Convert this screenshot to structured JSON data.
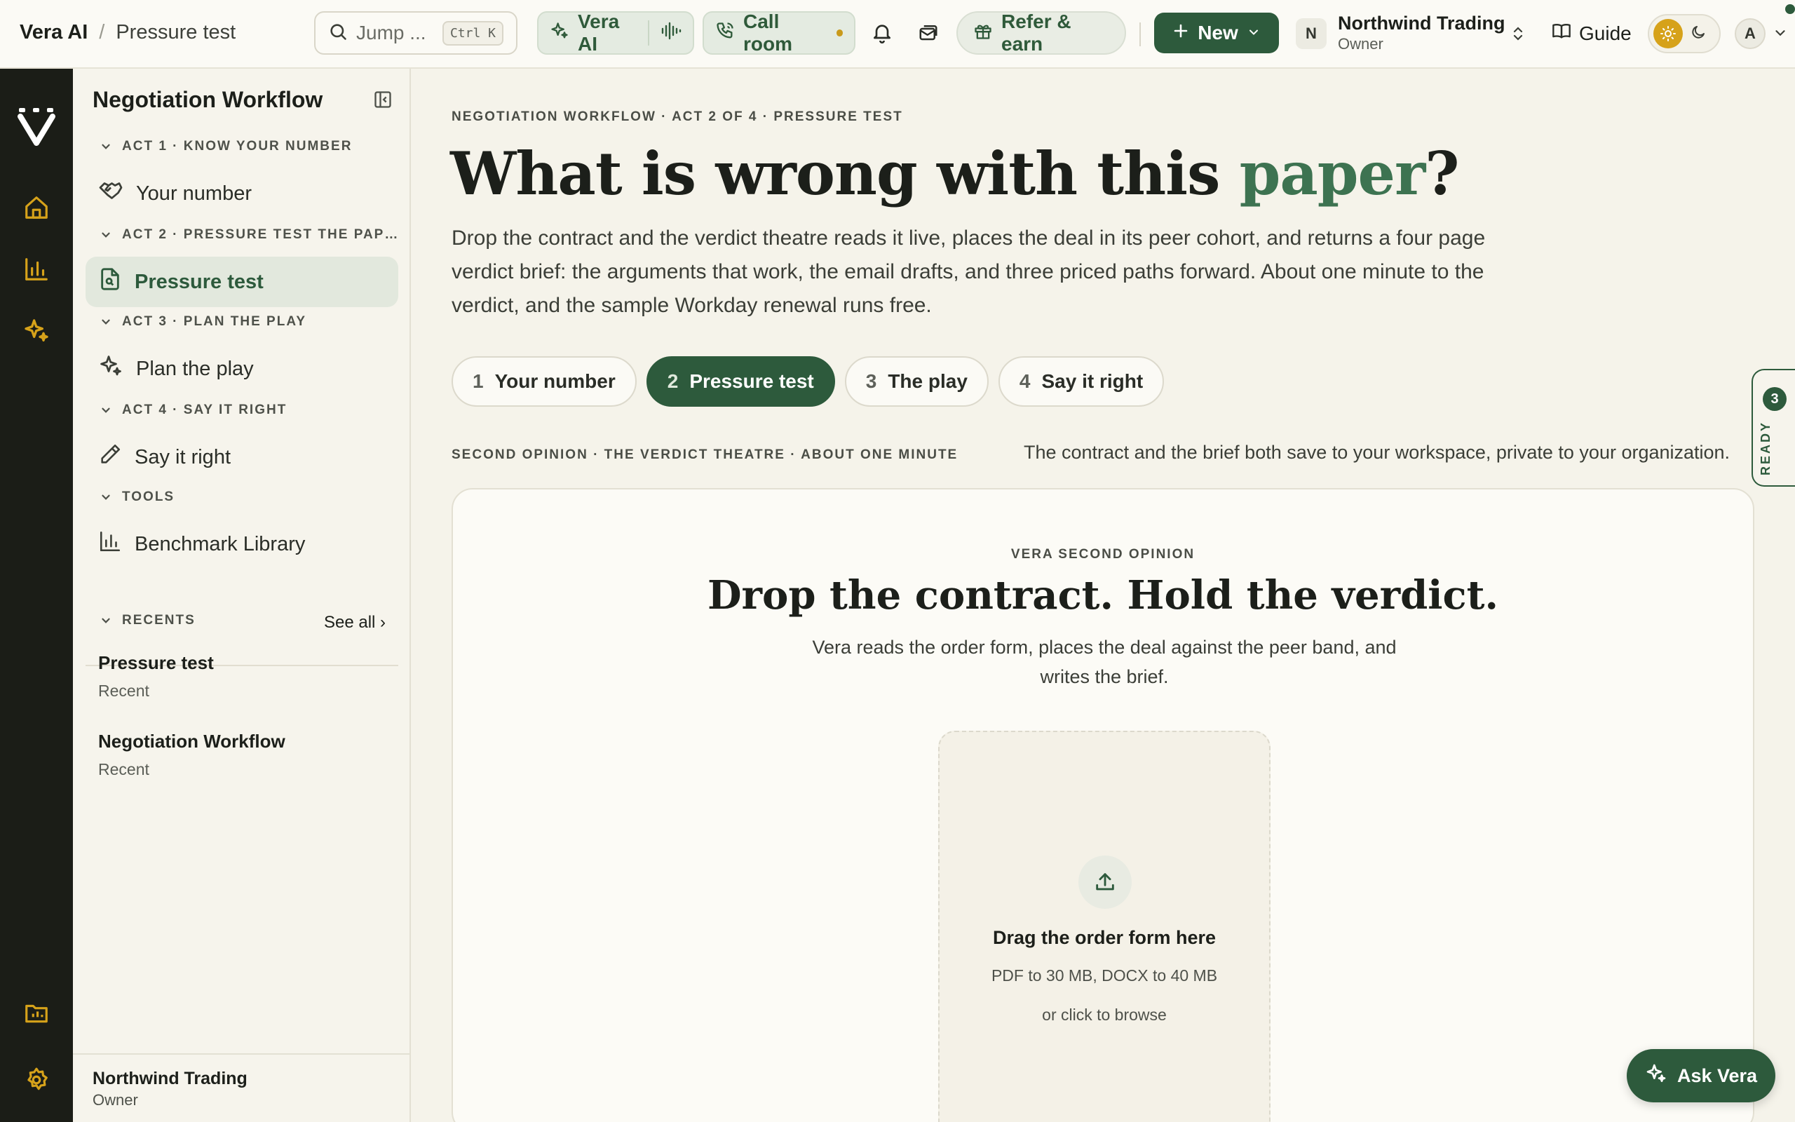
{
  "breadcrumb": {
    "app": "Vera AI",
    "separator": "/",
    "page": "Pressure test"
  },
  "topbar": {
    "search_placeholder": "Jump ...",
    "search_shortcut": "Ctrl K",
    "vera_label": "Vera AI",
    "call_label": "Call room",
    "refer_label": "Refer & earn",
    "new_label": "New",
    "org_initial": "N",
    "org_name": "Northwind Trading",
    "org_role": "Owner",
    "guide_label": "Guide",
    "avatar_initial": "A"
  },
  "sidebar": {
    "title": "Negotiation Workflow",
    "sections": [
      {
        "label": "ACT 1 · KNOW YOUR NUMBER",
        "item": "Your number"
      },
      {
        "label": "ACT 2 · PRESSURE TEST THE PAP…",
        "item": "Pressure test"
      },
      {
        "label": "ACT 3 · PLAN THE PLAY",
        "item": "Plan the play"
      },
      {
        "label": "ACT 4 · SAY IT RIGHT",
        "item": "Say it right"
      },
      {
        "label": "TOOLS",
        "item": "Benchmark Library"
      }
    ],
    "recents_label": "RECENTS",
    "see_all": "See all ›",
    "recents": [
      {
        "title": "Pressure test",
        "sub": "Recent"
      },
      {
        "title": "Negotiation Workflow",
        "sub": "Recent"
      }
    ],
    "footer": {
      "name": "Northwind Trading",
      "role": "Owner"
    }
  },
  "main": {
    "eyebrow": "NEGOTIATION WORKFLOW · ACT 2 OF 4 · PRESSURE TEST",
    "headline_lead": "What is wrong with this ",
    "headline_accent": "paper",
    "headline_tail": "?",
    "lede": "Drop the contract and the verdict theatre reads it live, places the deal in its peer cohort, and returns a four page verdict brief: the arguments that work, the email drafts, and three priced paths forward. About one minute to the verdict, and the sample Workday renewal runs free.",
    "steps": [
      {
        "num": "1",
        "label": "Your number"
      },
      {
        "num": "2",
        "label": "Pressure test"
      },
      {
        "num": "3",
        "label": "The play"
      },
      {
        "num": "4",
        "label": "Say it right"
      }
    ],
    "second_opinion_label": "SECOND OPINION · THE VERDICT THEATRE · ABOUT ONE MINUTE",
    "save_note": "The contract and the brief both save to your workspace, private to your organization.",
    "card": {
      "eyebrow": "VERA SECOND OPINION",
      "title": "Drop the contract. Hold the verdict.",
      "subtitle": "Vera reads the order form, places the deal against the peer band, and writes the brief.",
      "dropzone_title": "Drag the order form here",
      "dropzone_limits": "PDF to 30 MB, DOCX to 40 MB",
      "dropzone_browse": "or click to browse"
    }
  },
  "ready_tab": {
    "count": "3",
    "label": "READY"
  },
  "fab": {
    "label": "Ask Vera"
  },
  "colors": {
    "brand_green": "#2d5a3c",
    "accent_green": "#3d7351",
    "rail": "#1b1d17",
    "gold": "#d6a21a",
    "page_bg": "#f5f3ea"
  }
}
